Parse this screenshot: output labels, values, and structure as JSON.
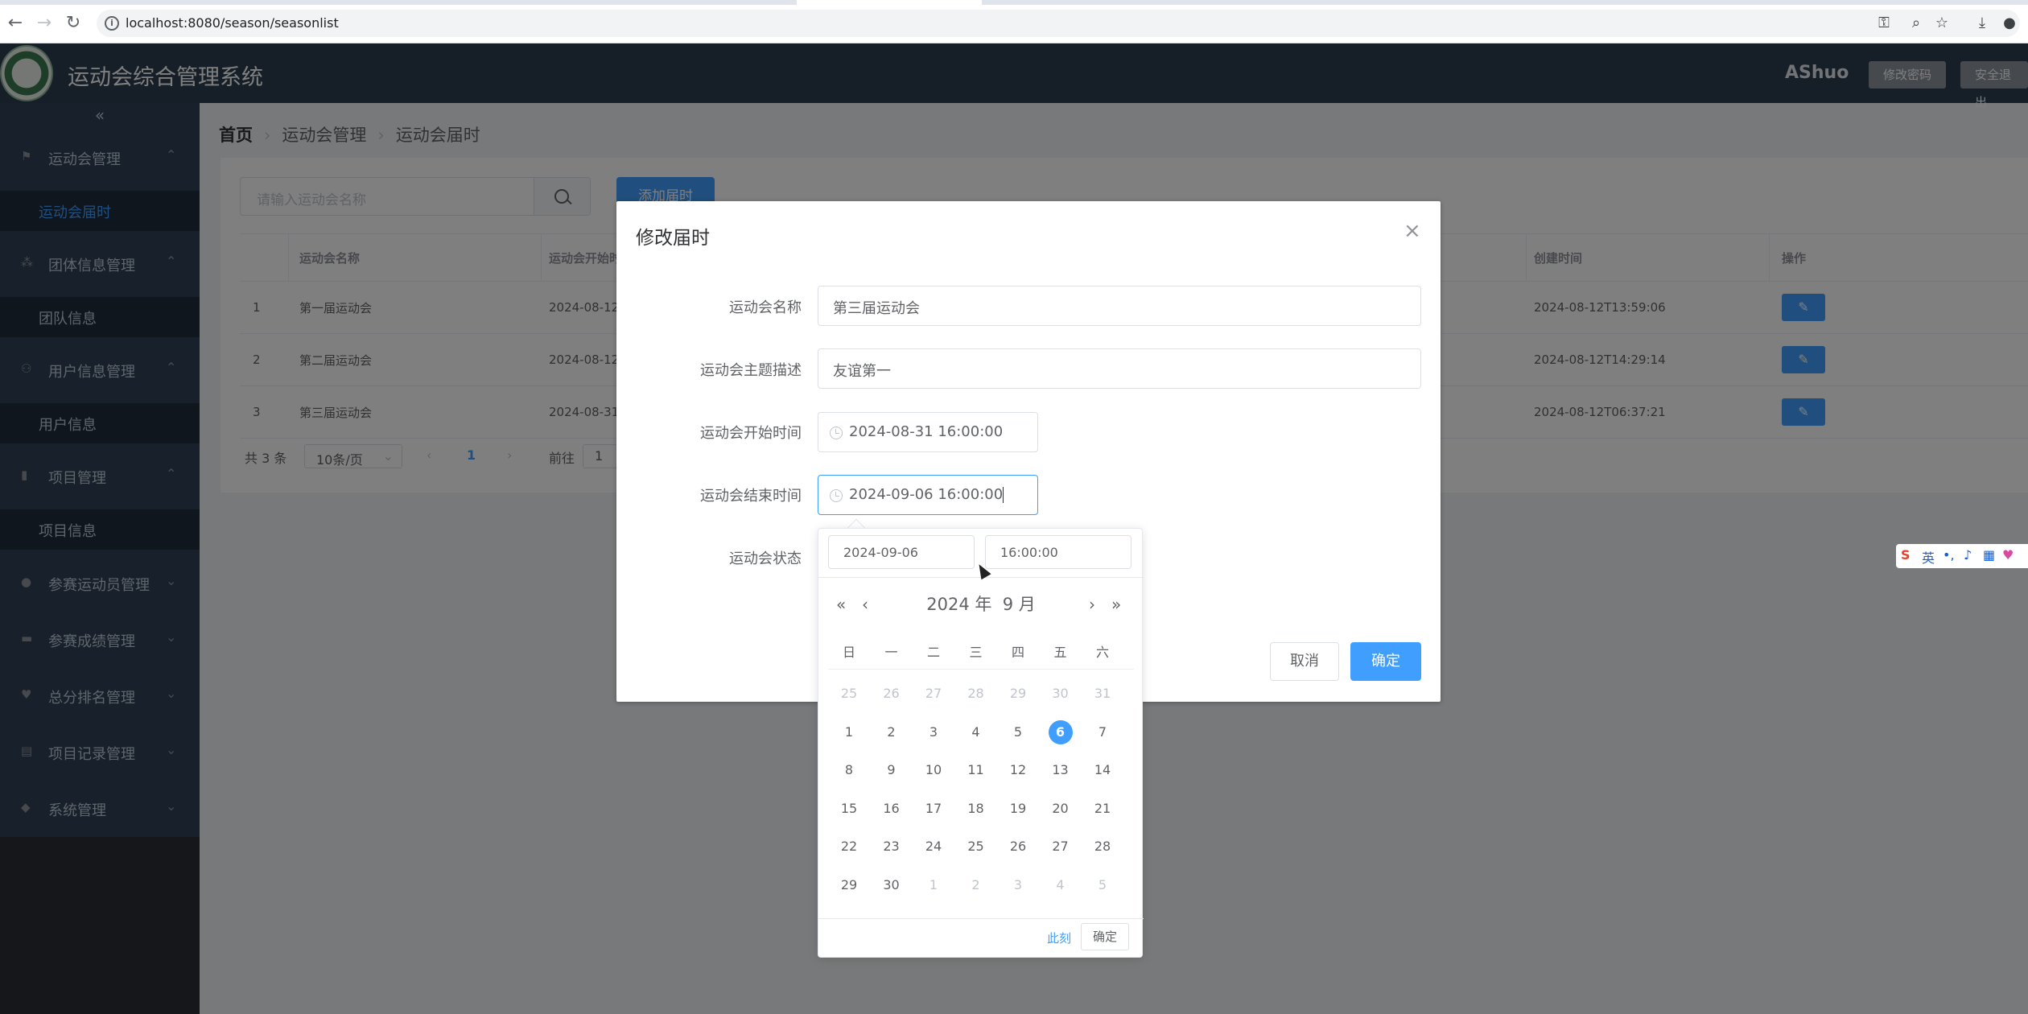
{
  "browser": {
    "url": "localhost:8080/season/seasonlist",
    "back_icon": "arrow-left-icon",
    "forward_icon": "arrow-right-icon",
    "reload_icon": "reload-icon"
  },
  "header": {
    "title": "运动会综合管理系统",
    "user": "AShuo",
    "change_password": "修改密码",
    "logout": "安全退出"
  },
  "sidebar": {
    "collapse": "«",
    "items": [
      {
        "label": "运动会管理",
        "icon": "trophy-icon"
      },
      {
        "label": "运动会届时",
        "sub": true,
        "active": true
      },
      {
        "label": "团体信息管理",
        "icon": "team-icon"
      },
      {
        "label": "团队信息",
        "sub": true
      },
      {
        "label": "用户信息管理",
        "icon": "users-icon"
      },
      {
        "label": "用户信息",
        "sub": true
      },
      {
        "label": "项目管理",
        "icon": "document-icon"
      },
      {
        "label": "项目信息",
        "sub": true
      },
      {
        "label": "参赛运动员管理",
        "icon": "user-icon"
      },
      {
        "label": "参赛成绩管理",
        "icon": "score-icon"
      },
      {
        "label": "总分排名管理",
        "icon": "ranking-icon"
      },
      {
        "label": "项目记录管理",
        "icon": "record-icon"
      },
      {
        "label": "系统管理",
        "icon": "settings-icon"
      }
    ]
  },
  "breadcrumb": {
    "home": "首页",
    "level1": "运动会管理",
    "level2": "运动会届时"
  },
  "toolbar": {
    "search_placeholder": "请输入运动会名称",
    "add_label": "添加届时"
  },
  "table": {
    "headers": {
      "name": "运动会名称",
      "start": "运动会开始时",
      "created": "创建时间",
      "op": "操作"
    },
    "rows": [
      {
        "idx": "1",
        "name": "第一届运动会",
        "start": "2024-08-12",
        "created": "2024-08-12T13:59:06"
      },
      {
        "idx": "2",
        "name": "第二届运动会",
        "start": "2024-08-12",
        "created": "2024-08-12T14:29:14"
      },
      {
        "idx": "3",
        "name": "第三届运动会",
        "start": "2024-08-31",
        "created": "2024-08-12T06:37:21"
      }
    ]
  },
  "pager": {
    "total": "共 3 条",
    "size": "10条/页",
    "page": "1",
    "goto": "前往",
    "goto_value": "1"
  },
  "dialog": {
    "title": "修改届时",
    "fields": {
      "name_label": "运动会名称",
      "name_value": "第三届运动会",
      "theme_label": "运动会主题描述",
      "theme_value": "友谊第一",
      "start_label": "运动会开始时间",
      "start_value": "2024-08-31 16:00:00",
      "end_label": "运动会结束时间",
      "end_value": "2024-09-06 16:00:00",
      "status_label": "运动会状态"
    },
    "cancel": "取消",
    "confirm": "确定"
  },
  "picker": {
    "date_value": "2024-09-06",
    "time_value": "16:00:00",
    "year_label": "2024 年",
    "month_label": "9 月",
    "weekdays": [
      "日",
      "一",
      "二",
      "三",
      "四",
      "五",
      "六"
    ],
    "days": [
      [
        "25",
        "26",
        "27",
        "28",
        "29",
        "30",
        "31"
      ],
      [
        "1",
        "2",
        "3",
        "4",
        "5",
        "6",
        "7"
      ],
      [
        "8",
        "9",
        "10",
        "11",
        "12",
        "13",
        "14"
      ],
      [
        "15",
        "16",
        "17",
        "18",
        "19",
        "20",
        "21"
      ],
      [
        "22",
        "23",
        "24",
        "25",
        "26",
        "27",
        "28"
      ],
      [
        "29",
        "30",
        "1",
        "2",
        "3",
        "4",
        "5"
      ]
    ],
    "selected": "6",
    "now": "此刻",
    "ok": "确定"
  }
}
